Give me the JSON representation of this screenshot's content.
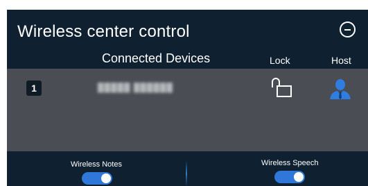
{
  "header": {
    "title": "Wireless center control",
    "close_icon": "minus-circle-icon"
  },
  "columns": {
    "devices": "Connected Devices",
    "lock": "Lock",
    "host": "Host"
  },
  "devices": [
    {
      "index": "1",
      "name": "█████ ██████",
      "lock_state": "unlocked",
      "lock_icon": "unlocked-padlock-icon",
      "host_icon": "host-user-icon",
      "host_color": "#2f7de0"
    }
  ],
  "toggles": {
    "wireless_notes": {
      "label": "Wireless Notes",
      "on": true
    },
    "wireless_speech": {
      "label": "Wireless Speech",
      "on": true
    }
  },
  "colors": {
    "panel_bg": "#0f2030",
    "list_bg": "#4a4d54",
    "accent": "#2f78d9"
  }
}
